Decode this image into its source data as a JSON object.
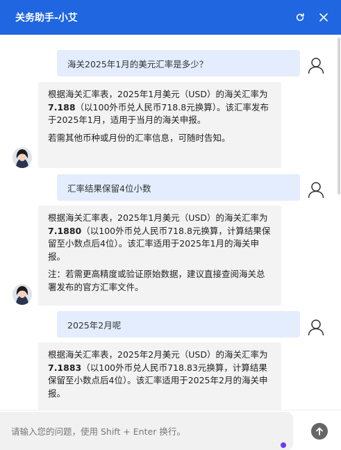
{
  "header": {
    "title": "关务助手-小艾",
    "refresh_icon": "refresh-icon",
    "close_icon": "close-icon"
  },
  "messages": [
    {
      "role": "user",
      "text": "海关2025年1月的美元汇率是多少？"
    },
    {
      "role": "assistant",
      "p1_pre": "根据海关汇率表，2025年1月美元（USD）的海关汇率为 ",
      "p1_bold": "7.188",
      "p1_post": "（以100外币兑人民币718.8元换算）。该汇率发布于2025年1月，适用于当月的海关申报。",
      "p2": "若需其他币种或月份的汇率信息，可随时告知。"
    },
    {
      "role": "user",
      "text": "汇率结果保留4位小数"
    },
    {
      "role": "assistant",
      "p1_pre": "根据海关汇率表，2025年1月美元（USD）的海关汇率为 ",
      "p1_bold": "7.1880",
      "p1_post": "（以100外币兑人民币718.8元换算，计算结果保留至小数点后4位）。该汇率适用于2025年1月的海关申报。",
      "p2": "注：若需更高精度或验证原始数据，建议直接查阅海关总署发布的官方汇率文件。"
    },
    {
      "role": "user",
      "text": "2025年2月呢"
    },
    {
      "role": "assistant",
      "p1_pre": "根据海关汇率表，2025年2月美元（USD）的海关汇率为 ",
      "p1_bold": "7.1883",
      "p1_post": "（以100外币兑人民币718.83元换算，计算结果保留至小数点后4位）。该汇率适用于2025年2月的海关申报。"
    }
  ],
  "input": {
    "placeholder": "请输入您的问题，使用 Shift + Enter 换行。",
    "value": ""
  },
  "colors": {
    "header": "#1f66e0",
    "user_bubble": "#e3edfd",
    "assistant_bubble": "#f3f3f3",
    "status_dot": "#6a3cf0"
  }
}
